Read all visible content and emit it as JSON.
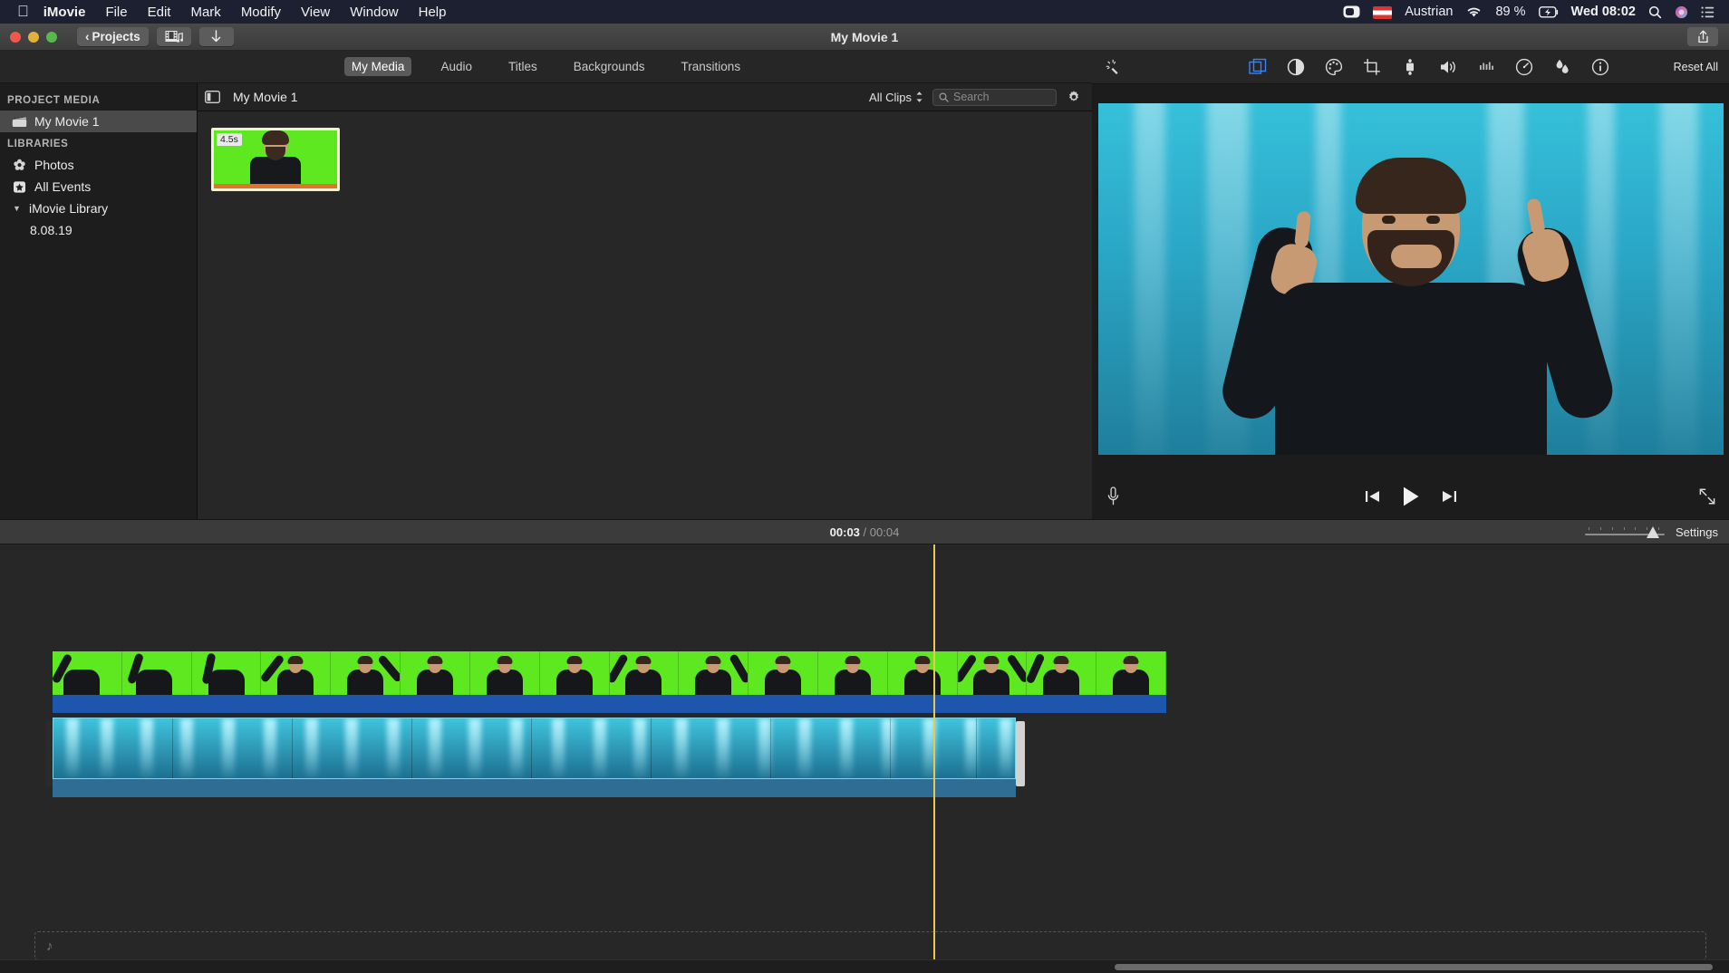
{
  "menubar": {
    "apple_icon": "apple-icon",
    "items": [
      "iMovie",
      "File",
      "Edit",
      "Mark",
      "Modify",
      "View",
      "Window",
      "Help"
    ],
    "status": {
      "video_icon": "video-camera-icon",
      "flag_icon": "austrian-flag-icon",
      "input_source": "Austrian",
      "wifi_icon": "wifi-icon",
      "battery": "89 %",
      "battery_icon": "battery-charging-icon",
      "clock": "Wed 08:02",
      "search_icon": "spotlight-search-icon",
      "siri_icon": "siri-icon",
      "control_center_icon": "control-center-icon"
    }
  },
  "titlebar": {
    "back_label": "Projects",
    "back_icon": "chevron-left-icon",
    "media_button_icon": "film-music-icon",
    "import_button_icon": "download-arrow-icon",
    "title": "My Movie 1",
    "share_icon": "share-icon"
  },
  "browser": {
    "tabs": [
      {
        "label": "My Media",
        "active": true
      },
      {
        "label": "Audio",
        "active": false
      },
      {
        "label": "Titles",
        "active": false
      },
      {
        "label": "Backgrounds",
        "active": false
      },
      {
        "label": "Transitions",
        "active": false
      }
    ],
    "sidebar": {
      "section_project": "PROJECT MEDIA",
      "project_item": {
        "label": "My Movie 1",
        "icon": "clapperboard-icon",
        "selected": true
      },
      "section_libraries": "LIBRARIES",
      "items": [
        {
          "label": "Photos",
          "icon": "photos-flower-icon"
        },
        {
          "label": "All Events",
          "icon": "star-badge-icon"
        },
        {
          "label": "iMovie Library",
          "icon": "disclosure-triangle-icon"
        },
        {
          "label": "8.08.19",
          "icon": "event-icon"
        }
      ]
    },
    "header": {
      "layout_icon": "sidebar-toggle-icon",
      "title": "My Movie 1",
      "filter_label": "All Clips",
      "filter_icon": "stepper-chevrons-icon",
      "search_icon": "search-icon",
      "search_placeholder": "Search",
      "search_value": "",
      "settings_icon": "gear-icon"
    },
    "clips": [
      {
        "duration_badge": "4.5s",
        "selected": true,
        "background_color": "#5ee81f"
      }
    ]
  },
  "viewer": {
    "toolbar": {
      "auto_enhance_icon": "magic-wand-icon",
      "tools": [
        {
          "name": "video-overlay-icon",
          "active": true
        },
        {
          "name": "color-balance-icon",
          "active": false
        },
        {
          "name": "color-correction-palette-icon",
          "active": false
        },
        {
          "name": "crop-icon",
          "active": false
        },
        {
          "name": "stabilization-camera-icon",
          "active": false
        },
        {
          "name": "volume-icon",
          "active": false
        },
        {
          "name": "noise-reduction-equalizer-icon",
          "active": false
        },
        {
          "name": "speed-icon",
          "active": false
        },
        {
          "name": "filters-droplets-icon",
          "active": false
        },
        {
          "name": "info-icon",
          "active": false
        }
      ],
      "reset_label": "Reset All"
    },
    "watermark": "",
    "controls": {
      "voiceover_icon": "microphone-icon",
      "skip_back_icon": "skip-back-icon",
      "play_icon": "play-icon",
      "skip_forward_icon": "skip-forward-icon",
      "fullscreen_icon": "expand-arrows-icon"
    }
  },
  "timeline": {
    "current_time": "00:03",
    "separator": "/",
    "total_time": "00:04",
    "zoom_slider_icon": "zoom-slider",
    "settings_label": "Settings",
    "tracks": [
      {
        "name": "video-clip-green-screen",
        "color": "#5ee81f"
      },
      {
        "name": "audio-waveform-band",
        "color": "#1e56ad"
      },
      {
        "name": "background-clip-underwater",
        "color": "#3fc4dd"
      }
    ],
    "music_drop_icon": "music-note-icon"
  }
}
